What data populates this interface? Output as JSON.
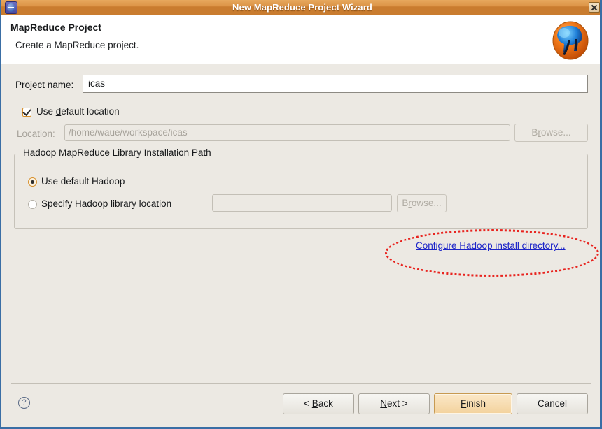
{
  "window": {
    "title": "New MapReduce Project Wizard",
    "app_icon": "eclipse-icon",
    "close_label": "Close"
  },
  "header": {
    "title": "MapReduce Project",
    "subtitle": "Create a MapReduce project.",
    "logo_icon": "hadoop-elephant-logo"
  },
  "form": {
    "project_name_label_pre": "P",
    "project_name_label_post": "roject name:",
    "project_name_value": "icas",
    "use_default_location_label_pre": "Use ",
    "use_default_location_label_key": "d",
    "use_default_location_label_post": "efault location",
    "use_default_location_checked": true,
    "location_label_pre": "L",
    "location_label_post": "ocation:",
    "location_value": "/home/waue/workspace/icas",
    "location_enabled": false,
    "browse_label_pre": "B",
    "browse_label_key": "r",
    "browse_label_post": "owse...",
    "browse_enabled": false
  },
  "group": {
    "legend": "Hadoop MapReduce Library Installation Path",
    "option_default_label": "Use default Hadoop",
    "option_default_selected": true,
    "option_specify_label": "Specify Hadoop library location",
    "option_specify_selected": false,
    "specify_value": "",
    "specify_browse_label_pre": "B",
    "specify_browse_label_key": "r",
    "specify_browse_label_post": "owse...",
    "specify_browse_enabled": false,
    "configure_link_label": "Configure Hadoop install directory...",
    "annotation_color": "#e8241f",
    "link_color": "#1c24c8"
  },
  "footer": {
    "help_glyph": "?",
    "back_pre": "< ",
    "back_key": "B",
    "back_post": "ack",
    "next_key": "N",
    "next_post": "ext >",
    "finish_key": "F",
    "finish_post": "inish",
    "cancel_label": "Cancel",
    "default_button": "Finish"
  },
  "colors": {
    "titlebar_accent": "#dc9447",
    "dialog_bg": "#ece9e3",
    "highlight_orange": "#d78f2a"
  }
}
